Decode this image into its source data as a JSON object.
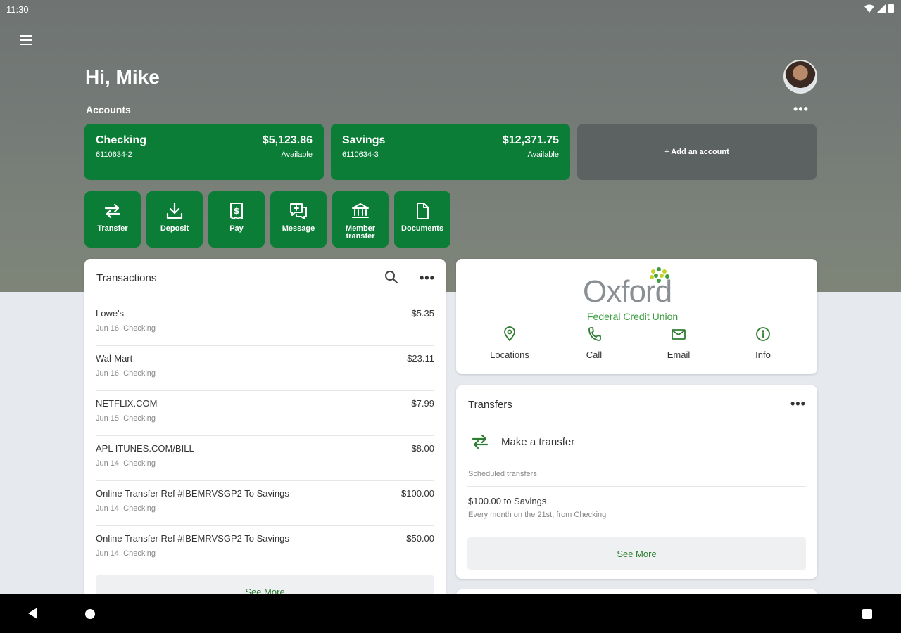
{
  "status": {
    "time": "11:30"
  },
  "header": {
    "greeting": "Hi, Mike",
    "accounts_label": "Accounts"
  },
  "accounts": [
    {
      "name": "Checking",
      "number": "6110634-2",
      "balance": "$5,123.86",
      "balance_label": "Available"
    },
    {
      "name": "Savings",
      "number": "6110634-3",
      "balance": "$12,371.75",
      "balance_label": "Available"
    }
  ],
  "add_account_label": "+ Add an account",
  "actions": [
    {
      "label": "Transfer",
      "icon": "transfer-icon"
    },
    {
      "label": "Deposit",
      "icon": "deposit-icon"
    },
    {
      "label": "Pay",
      "icon": "bill-pay-icon"
    },
    {
      "label": "Message",
      "icon": "message-icon"
    },
    {
      "label": "Member transfer",
      "icon": "bank-icon"
    },
    {
      "label": "Documents",
      "icon": "document-icon"
    }
  ],
  "transactions": {
    "title": "Transactions",
    "items": [
      {
        "merchant": "Lowe's",
        "sub": "Jun 16, Checking",
        "amount": "$5.35"
      },
      {
        "merchant": "Wal-Mart",
        "sub": "Jun 16, Checking",
        "amount": "$23.11"
      },
      {
        "merchant": "NETFLIX.COM",
        "sub": "Jun 15, Checking",
        "amount": "$7.99"
      },
      {
        "merchant": "APL ITUNES.COM/BILL",
        "sub": "Jun 14, Checking",
        "amount": "$8.00"
      },
      {
        "merchant": "Online Transfer Ref #IBEMRVSGP2 To Savings",
        "sub": "Jun 14, Checking",
        "amount": "$100.00"
      },
      {
        "merchant": "Online Transfer Ref #IBEMRVSGP2 To Savings",
        "sub": "Jun 14, Checking",
        "amount": "$50.00"
      }
    ],
    "see_more": "See More"
  },
  "credit_union": {
    "logo_word": "Oxford",
    "logo_sub": "Federal Credit Union",
    "actions": [
      {
        "label": "Locations",
        "icon": "location-pin-icon"
      },
      {
        "label": "Call",
        "icon": "phone-icon"
      },
      {
        "label": "Email",
        "icon": "email-icon"
      },
      {
        "label": "Info",
        "icon": "info-icon"
      }
    ]
  },
  "transfers": {
    "title": "Transfers",
    "make_transfer": "Make a transfer",
    "scheduled_label": "Scheduled transfers",
    "scheduled": [
      {
        "title": "$100.00 to Savings",
        "detail": "Every month on the 21st, from Checking"
      }
    ],
    "see_more": "See More"
  },
  "colors": {
    "brand_green": "#0b7d37",
    "link_green": "#2e7d32",
    "card_gray": "#5c6162"
  }
}
